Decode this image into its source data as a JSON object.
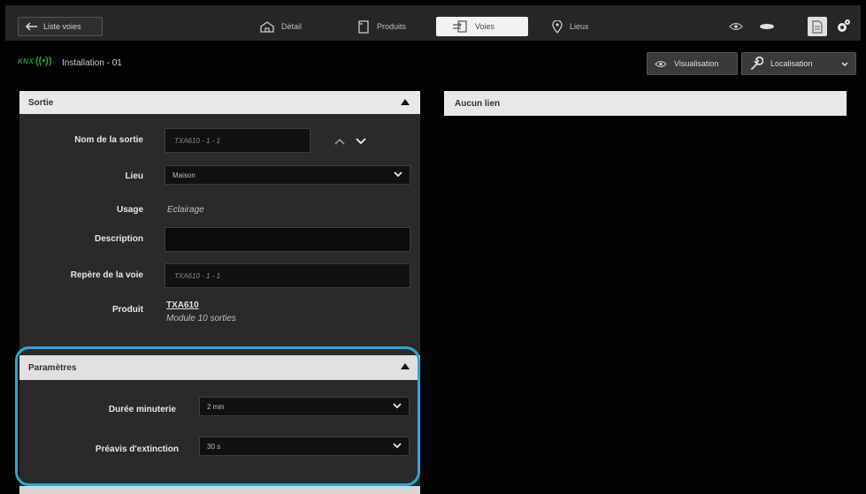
{
  "topbar": {
    "back_label": "Liste voies",
    "tabs": [
      {
        "label": "Détail"
      },
      {
        "label": "Produits"
      },
      {
        "label": "Voies"
      },
      {
        "label": "Lieux"
      }
    ]
  },
  "header": {
    "knx": "KNX",
    "title": "Installation - 01",
    "visualisation_label": "Visualisation",
    "localisation_label": "Localisation"
  },
  "sortie": {
    "title": "Sortie",
    "nom_label": "Nom de la sortie",
    "nom_value": "TXA610 - 1 - 1",
    "lieu_label": "Lieu",
    "lieu_value": "Maison",
    "usage_label": "Usage",
    "usage_value": "Eclairage",
    "description_label": "Description",
    "description_value": "",
    "repere_label": "Repère de la voie",
    "repere_value": "TXA610 - 1 - 1",
    "produit_label": "Produit",
    "produit_ref": "TXA610",
    "produit_desc": "Module 10 sorties"
  },
  "parametres": {
    "title": "Paramètres",
    "duree_label": "Durée minuterie",
    "duree_value": "2 min",
    "preavis_label": "Préavis d'extinction",
    "preavis_value": "30 s"
  },
  "right": {
    "title": "Aucun lien"
  },
  "colors": {
    "highlight": "#2aa7d6",
    "knx_green": "#2e8b2e"
  }
}
